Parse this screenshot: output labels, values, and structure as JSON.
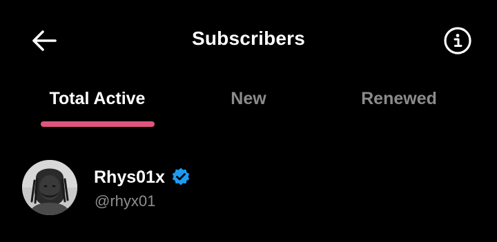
{
  "header": {
    "title": "Subscribers",
    "back_icon": "arrow-left-icon",
    "info_icon": "info-circle-icon"
  },
  "tabs": [
    {
      "label": "Total Active",
      "active": true
    },
    {
      "label": "New",
      "active": false
    },
    {
      "label": "Renewed",
      "active": false
    }
  ],
  "colors": {
    "background": "#000000",
    "accent": "#e0557f",
    "verified": "#1d9bf0",
    "muted_text": "#8e8e8e"
  },
  "subscribers": [
    {
      "display_name": "Rhys01x",
      "handle": "@rhyx01",
      "verified": true,
      "avatar_icon": "avatar"
    }
  ]
}
